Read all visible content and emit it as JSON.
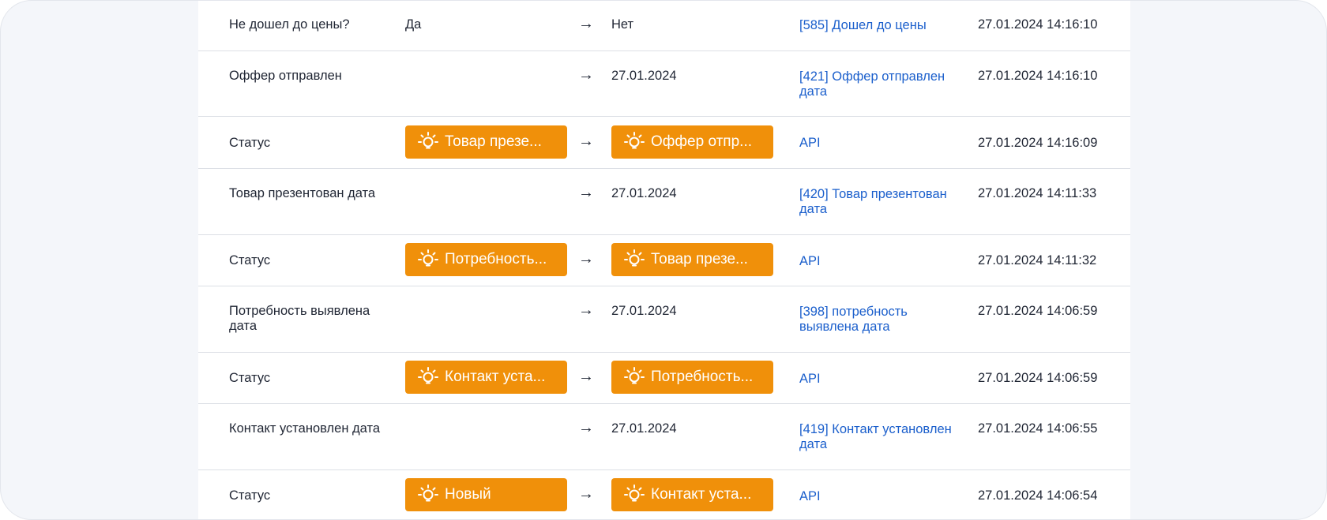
{
  "history": {
    "rows": [
      {
        "type": "text",
        "field": "Не дошел до цены?",
        "old": "Да",
        "new": "Нет",
        "source": "[585] Дошел до цены",
        "time": "27.01.2024 14:16:10"
      },
      {
        "type": "text",
        "field": "Оффер отправлен",
        "old": "",
        "new": "27.01.2024",
        "source": "[421] Оффер отправлен дата",
        "time": "27.01.2024 14:16:10"
      },
      {
        "type": "status",
        "field": "Статус",
        "old": "Товар презе...",
        "new": "Оффер отпр...",
        "source": "API",
        "time": "27.01.2024 14:16:09"
      },
      {
        "type": "text",
        "field": "Товар презентован дата",
        "old": "",
        "new": "27.01.2024",
        "source": "[420] Товар презентован дата",
        "time": "27.01.2024 14:11:33"
      },
      {
        "type": "status",
        "field": "Статус",
        "old": "Потребность...",
        "new": "Товар презе...",
        "source": "API",
        "time": "27.01.2024 14:11:32"
      },
      {
        "type": "text",
        "field": "Потребность выявлена дата",
        "old": "",
        "new": "27.01.2024",
        "source": "[398] потребность выявлена дата",
        "time": "27.01.2024 14:06:59"
      },
      {
        "type": "status",
        "field": "Статус",
        "old": "Контакт уста...",
        "new": "Потребность...",
        "source": "API",
        "time": "27.01.2024 14:06:59"
      },
      {
        "type": "text",
        "field": "Контакт установлен дата",
        "old": "",
        "new": "27.01.2024",
        "source": "[419] Контакт установлен дата",
        "time": "27.01.2024 14:06:55"
      },
      {
        "type": "status",
        "field": "Статус",
        "old": "Новый",
        "new": "Контакт уста...",
        "source": "API",
        "time": "27.01.2024 14:06:54"
      }
    ],
    "arrow": "→",
    "status_icon": "lightbulb-icon",
    "colors": {
      "status_pill": "#f0900a",
      "link": "#1b5fcc",
      "text": "#1f2533"
    }
  }
}
